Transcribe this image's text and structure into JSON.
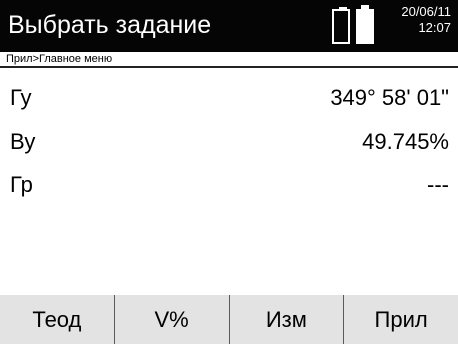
{
  "header": {
    "title": "Выбрать задание",
    "date": "20/06/11",
    "time": "12:07",
    "battery_icons": [
      "battery-empty-icon",
      "battery-full-icon"
    ]
  },
  "breadcrumb": "Прил>Главное меню",
  "measurements": [
    {
      "label": "Гу",
      "value": "349° 58' 01\""
    },
    {
      "label": "Ву",
      "value": "49.745%"
    },
    {
      "label": "Гр",
      "value": "---"
    }
  ],
  "softkeys": [
    {
      "label": "Теод"
    },
    {
      "label": "V%"
    },
    {
      "label": "Изм"
    },
    {
      "label": "Прил"
    }
  ]
}
